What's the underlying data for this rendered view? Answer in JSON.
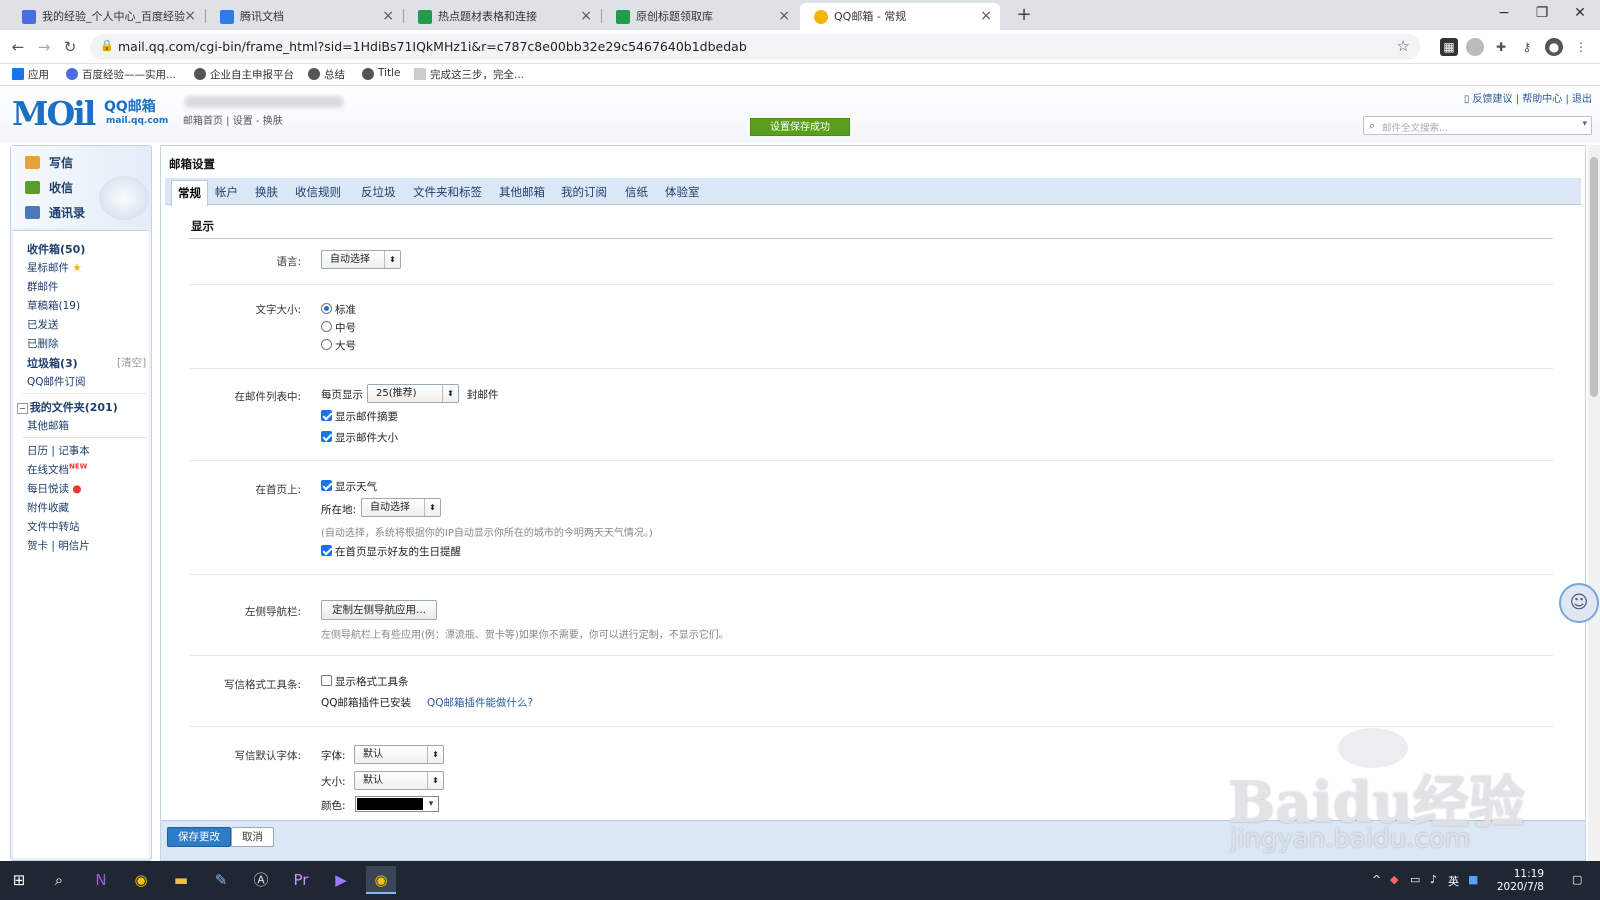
{
  "browser": {
    "tabs": [
      {
        "title": "我的经验_个人中心_百度经验",
        "icon_color": "#4a6ee0",
        "active": false
      },
      {
        "title": "腾讯文档",
        "icon_color": "#2b7de9",
        "active": false
      },
      {
        "title": "热点题材表格和连接",
        "icon_color": "#1e9e4a",
        "active": false
      },
      {
        "title": "原创标题领取库",
        "icon_color": "#1e9e4a",
        "active": false
      },
      {
        "title": "QQ邮箱 - 常规",
        "icon_color": "#f5b400",
        "active": true
      }
    ],
    "url": "mail.qq.com/cgi-bin/frame_html?sid=1HdiBs71IQkMHz1i&r=c787c8e00bb32e29c5467640b1dbedab",
    "bookmarks": [
      "应用",
      "百度经验——实用...",
      "企业自主申报平台",
      "总结",
      "Title",
      "完成这三步，完全..."
    ]
  },
  "mail_header": {
    "logo_text": "QQ邮箱",
    "logo_domain": "mail.qq.com",
    "home_links": "邮箱首页 | 设置 - 换肤",
    "top_links": "反馈建议 | 帮助中心 | 退出",
    "save_success": "设置保存成功",
    "search_placeholder": "邮件全文搜索..."
  },
  "sidebar": {
    "quick": [
      {
        "label": "写信",
        "icon_color": "#e8a13a"
      },
      {
        "label": "收信",
        "icon_color": "#5b9d2c"
      },
      {
        "label": "通讯录",
        "icon_color": "#4a78b8"
      }
    ],
    "folders": {
      "inbox": "收件箱(50)",
      "starred": "星标邮件",
      "group": "群邮件",
      "drafts": "草稿箱(19)",
      "sent": "已发送",
      "deleted": "已删除",
      "spam": "垃圾箱(3)",
      "spam_clear": "[清空]",
      "subscription": "QQ邮件订阅",
      "my_folders": "我的文件夹(201)",
      "other_mailbox": "其他邮箱",
      "calendar": "日历",
      "notes": "记事本",
      "online_docs": "在线文档",
      "new_badge": "NEW",
      "daily_read": "每日悦读",
      "attachments": "附件收藏",
      "file_transfer": "文件中转站",
      "cards": "贺卡",
      "postcards": "明信片"
    }
  },
  "settings": {
    "title": "邮箱设置",
    "tabs": [
      "常规",
      "帐户",
      "换肤",
      "收信规则",
      "反垃圾",
      "文件夹和标签",
      "其他邮箱",
      "我的订阅",
      "信纸",
      "体验室"
    ],
    "section": "显示",
    "language": {
      "label": "语言:",
      "value": "自动选择"
    },
    "font_size": {
      "label": "文字大小:",
      "options": [
        "标准",
        "中号",
        "大号"
      ],
      "selected": 0
    },
    "mail_list": {
      "label": "在邮件列表中:",
      "per_page_prefix": "每页显示",
      "per_page_value": "25(推荐)",
      "per_page_suffix": "封邮件",
      "show_summary": "显示邮件摘要",
      "show_size": "显示邮件大小"
    },
    "home_page": {
      "label": "在首页上:",
      "show_weather": "显示天气",
      "location_label": "所在地:",
      "location_value": "自动选择",
      "location_hint": "(自动选择，系统将根据你的IP自动显示你所在的城市的今明两天天气情况。)",
      "show_birthday": "在首页显示好友的生日提醒"
    },
    "left_nav": {
      "label": "左侧导航栏:",
      "button": "定制左侧导航应用...",
      "hint": "左侧导航栏上有些应用(例：漂流瓶、贺卡等)如果你不需要，你可以进行定制，不显示它们。"
    },
    "toolbar": {
      "label": "写信格式工具条:",
      "show_toolbar": "显示格式工具条",
      "plugin_installed": "QQ邮箱插件已安装",
      "plugin_link": "QQ邮箱插件能做什么?"
    },
    "default_font": {
      "label": "写信默认字体:",
      "font_label": "字体:",
      "font_value": "默认",
      "size_label": "大小:",
      "size_value": "默认",
      "color_label": "颜色:",
      "color_value": "#000000"
    },
    "save_button": "保存更改",
    "cancel_button": "取消"
  },
  "watermark": {
    "text": "Baidu经验",
    "url": "jingyan.baidu.com"
  },
  "taskbar": {
    "time": "11:19",
    "date": "2020/7/8",
    "ime": "英"
  }
}
